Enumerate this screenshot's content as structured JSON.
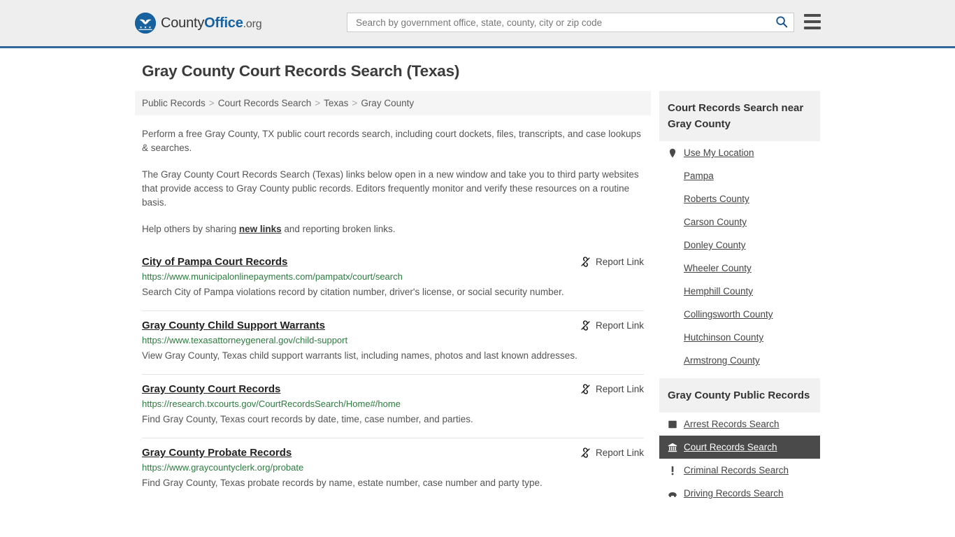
{
  "header": {
    "logo": {
      "word1": "County",
      "word2": "Office",
      "tld": ".org",
      "icon": "eagle-shield-icon"
    },
    "search": {
      "placeholder": "Search by government office, state, county, city or zip code",
      "value": "",
      "icon": "search-icon"
    },
    "menu_icon": "hamburger-menu-icon",
    "accent_color": "#336699",
    "background_color": "#eeeeee"
  },
  "page": {
    "title": "Gray County Court Records Search (Texas)"
  },
  "breadcrumb": {
    "separator": ">",
    "items": [
      {
        "label": "Public Records"
      },
      {
        "label": "Court Records Search"
      },
      {
        "label": "Texas"
      },
      {
        "label": "Gray County"
      }
    ]
  },
  "intro": {
    "p1": "Perform a free Gray County, TX public court records search, including court dockets, files, transcripts, and case lookups & searches.",
    "p2": "The Gray County Court Records Search (Texas) links below open in a new window and take you to third party websites that provide access to Gray County public records. Editors frequently monitor and verify these resources on a routine basis.",
    "p3_before": "Help others by sharing ",
    "p3_link": "new links",
    "p3_after": " and reporting broken links."
  },
  "results": {
    "report_label": "Report Link",
    "report_icon": "broken-link-icon",
    "items": [
      {
        "title": "City of Pampa Court Records",
        "url": "https://www.municipalonlinepayments.com/pampatx/court/search",
        "description": "Search City of Pampa violations record by citation number, driver's license, or social security number."
      },
      {
        "title": "Gray County Child Support Warrants",
        "url": "https://www.texasattorneygeneral.gov/child-support",
        "description": "View Gray County, Texas child support warrants list, including names, photos and last known addresses."
      },
      {
        "title": "Gray County Court Records",
        "url": "https://research.txcourts.gov/CourtRecordsSearch/Home#/home",
        "description": "Find Gray County, Texas court records by date, time, case number, and parties."
      },
      {
        "title": "Gray County Probate Records",
        "url": "https://www.graycountyclerk.org/probate",
        "description": "Find Gray County, Texas probate records by name, estate number, case number and party type."
      }
    ]
  },
  "sidebar": {
    "nearby": {
      "title": "Court Records Search near Gray County",
      "items": [
        {
          "label": "Use My Location",
          "icon": "map-pin-icon",
          "active": false
        },
        {
          "label": "Pampa",
          "icon": "",
          "active": false
        },
        {
          "label": "Roberts County",
          "icon": "",
          "active": false
        },
        {
          "label": "Carson County",
          "icon": "",
          "active": false
        },
        {
          "label": "Donley County",
          "icon": "",
          "active": false
        },
        {
          "label": "Wheeler County",
          "icon": "",
          "active": false
        },
        {
          "label": "Hemphill County",
          "icon": "",
          "active": false
        },
        {
          "label": "Collingsworth County",
          "icon": "",
          "active": false
        },
        {
          "label": "Hutchinson County",
          "icon": "",
          "active": false
        },
        {
          "label": "Armstrong County",
          "icon": "",
          "active": false
        }
      ]
    },
    "public_records": {
      "title": "Gray County Public Records",
      "items": [
        {
          "label": "Arrest Records Search",
          "icon": "id-card-icon",
          "active": false
        },
        {
          "label": "Court Records Search",
          "icon": "courthouse-icon",
          "active": true
        },
        {
          "label": "Criminal Records Search",
          "icon": "exclamation-icon",
          "active": false
        },
        {
          "label": "Driving Records Search",
          "icon": "car-icon",
          "active": false
        }
      ]
    },
    "active_highlight_color": "#4a4a4a"
  }
}
